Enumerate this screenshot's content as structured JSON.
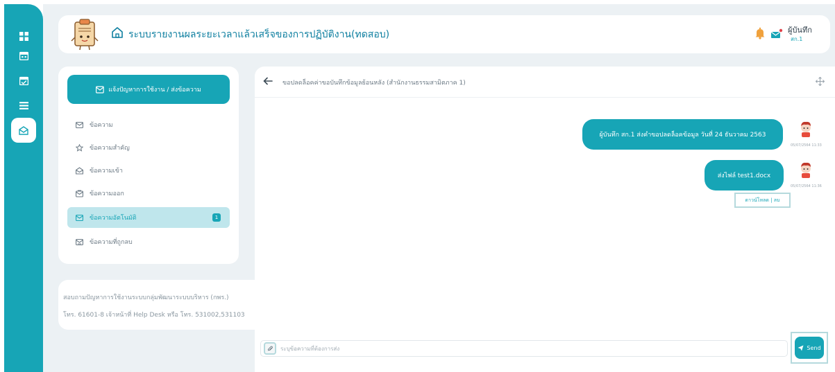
{
  "header": {
    "title": "ระบบรายงานผลระยะเวลาแล้วเสร็จของการปฏิบัติงาน(ทดสอบ)",
    "user_name": "ผู้บันทึก",
    "user_role": "สก.1"
  },
  "rail": {
    "icons": [
      "dashboard-icon",
      "calendar-icon",
      "calendar-check-icon",
      "list-icon",
      "mail-icon"
    ],
    "active_index": 4
  },
  "sidebar": {
    "compose_label": "แจ้งปัญหาการใช้งาน / ส่งข้อความ",
    "items": [
      {
        "label": "ข้อความ",
        "icon": "mail-icon"
      },
      {
        "label": "ข้อความสำคัญ",
        "icon": "star-icon"
      },
      {
        "label": "ข้อความเข้า",
        "icon": "inbox-icon"
      },
      {
        "label": "ข้อความออก",
        "icon": "outbox-icon"
      },
      {
        "label": "ข้อความอัตโนมัติ",
        "icon": "auto-mail-icon",
        "badge": "1"
      },
      {
        "label": "ข้อความที่ถูกลบ",
        "icon": "trash-mail-icon"
      }
    ],
    "active_index": 4
  },
  "contact": {
    "line1": "สอบถามปัญหาการใช้งานระบบกลุ่มพัฒนาระบบบริหาร (กพร.)",
    "line2": "โทร. 61601-8 เจ้าหน้าที่ Help Desk หรือ โทร. 531002,531103"
  },
  "chat": {
    "title": "ขอปลดล็อคค่าขอบันทึกข้อมูลย้อนหลัง (สำนักงานธรรมสามิตภาค 1)",
    "messages": [
      {
        "text": "ผู้บันทึก สก.1 ส่งคำขอปลดล็อคข้อมูล วันที่ 24 ธันวาคม 2563",
        "time": "05/07/2564 11:33"
      },
      {
        "text": "ส่งไฟล์ test1.docx",
        "time": "05/07/2564 11:36",
        "download_label": "ดาวน์โหลด | ลบ"
      }
    ],
    "input_placeholder": "ระบุข้อความที่ต้องการส่ง",
    "send_label": "Send"
  },
  "colors": {
    "accent": "#17a5b6",
    "background": "#ecf1f4",
    "bell": "#f0a13c",
    "mail_badge": "#e0434b"
  }
}
